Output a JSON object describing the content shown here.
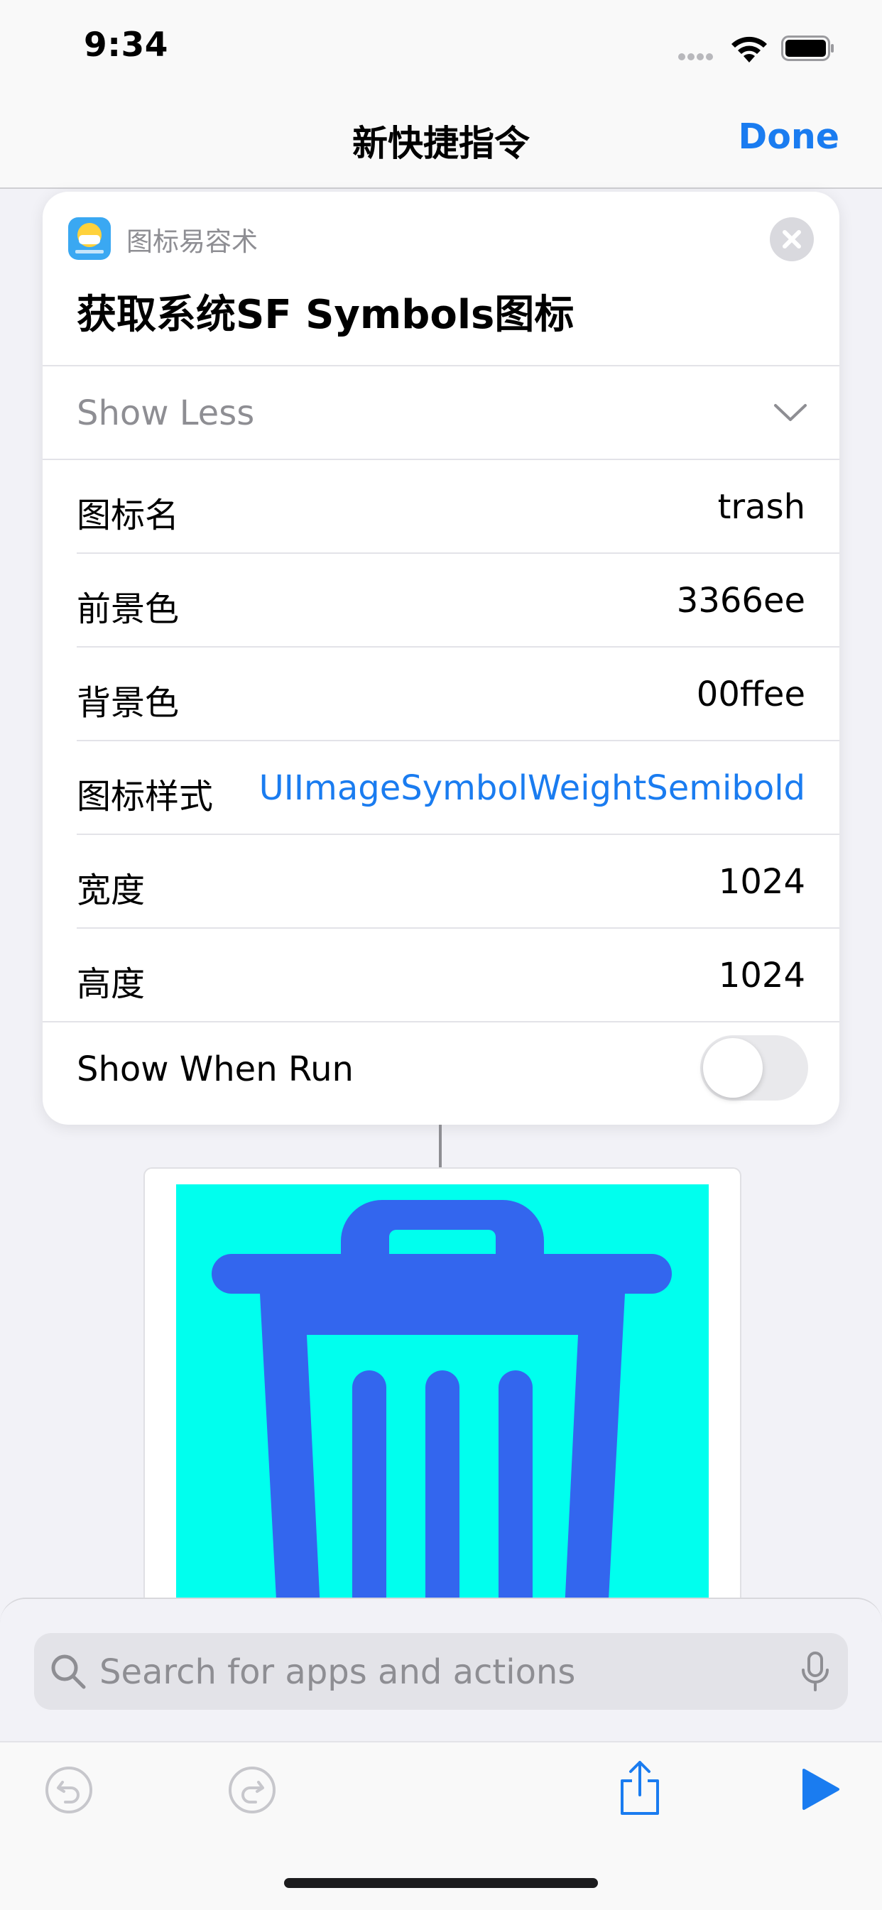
{
  "status_bar": {
    "time": "9:34",
    "icons": [
      "signal-dots-icon",
      "wifi-icon",
      "battery-icon"
    ]
  },
  "nav": {
    "title": "新快捷指令",
    "done_label": "Done"
  },
  "action_card": {
    "app_name": "图标易容术",
    "app_icon": "app-mask-face-icon",
    "title": "获取系统SF Symbols图标",
    "show_less_label": "Show Less",
    "params": [
      {
        "label": "图标名",
        "value": "trash"
      },
      {
        "label": "前景色",
        "value": "3366ee"
      },
      {
        "label": "背景色",
        "value": "00ffee"
      },
      {
        "label": "图标样式",
        "value": "UIImageSymbolWeightSemibold"
      },
      {
        "label": "宽度",
        "value": "1024"
      },
      {
        "label": "高度",
        "value": "1024"
      }
    ],
    "show_when_run_label": "Show When Run",
    "show_when_run": false
  },
  "preview": {
    "icon": "trash-icon",
    "foreground": "#3366ee",
    "background": "#00ffee"
  },
  "search": {
    "placeholder": "Search for apps and actions"
  },
  "toolbar": {
    "icons": [
      "undo-icon",
      "redo-icon",
      "share-icon",
      "play-icon"
    ]
  },
  "colors": {
    "accent": "#1a7cf0"
  }
}
